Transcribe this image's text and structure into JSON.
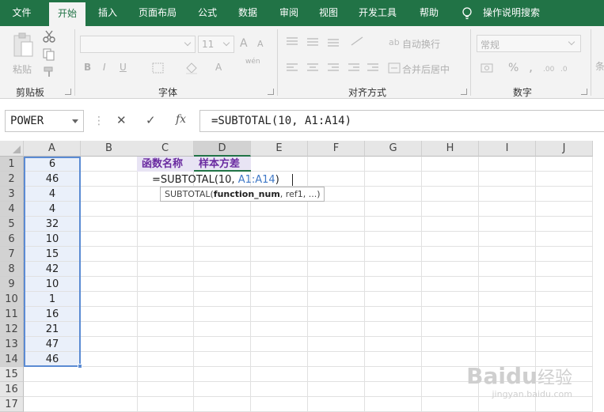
{
  "menu": {
    "tabs": [
      "文件",
      "开始",
      "插入",
      "页面布局",
      "公式",
      "数据",
      "审阅",
      "视图",
      "开发工具",
      "帮助"
    ],
    "active_index": 1,
    "tell_me": "操作说明搜索"
  },
  "ribbon": {
    "clipboard": {
      "paste": "粘贴",
      "group": "剪贴板"
    },
    "font": {
      "size": "11",
      "bold": "B",
      "italic": "I",
      "underline": "U",
      "font_color": "A",
      "phonetic": "wén",
      "grow": "A",
      "shrink": "A",
      "group": "字体"
    },
    "alignment": {
      "wrap": "自动换行",
      "merge": "合并后居中",
      "group": "对齐方式"
    },
    "number": {
      "format": "常规",
      "percent": "%",
      "comma": ",",
      "group": "数字",
      "more": "条"
    }
  },
  "formula_bar": {
    "name_box": "POWER",
    "cancel": "✕",
    "enter": "✓",
    "fx": "fx",
    "formula": "=SUBTOTAL(10, A1:A14)"
  },
  "sheet": {
    "columns": [
      "A",
      "B",
      "C",
      "D",
      "E",
      "F",
      "G",
      "H",
      "I",
      "J"
    ],
    "rows": [
      "1",
      "2",
      "3",
      "4",
      "5",
      "6",
      "7",
      "8",
      "9",
      "10",
      "11",
      "12",
      "13",
      "14",
      "15",
      "16",
      "17"
    ],
    "colA_values": [
      "6",
      "46",
      "4",
      "4",
      "32",
      "10",
      "15",
      "42",
      "10",
      "1",
      "16",
      "21",
      "47",
      "46"
    ],
    "c1": "函数名称",
    "d1": "样本方差",
    "edit_prefix": "=SUBTOTAL(10, ",
    "edit_ref": "A1:A14",
    "edit_suffix": ")",
    "tooltip_func": "SUBTOTAL(",
    "tooltip_arg": "function_num",
    "tooltip_rest": ", ref1, ...)"
  },
  "watermark": {
    "brand": "Bai",
    "brand2": "du",
    "brand_cn": "经验",
    "url": "jingyan.baidu.com"
  }
}
